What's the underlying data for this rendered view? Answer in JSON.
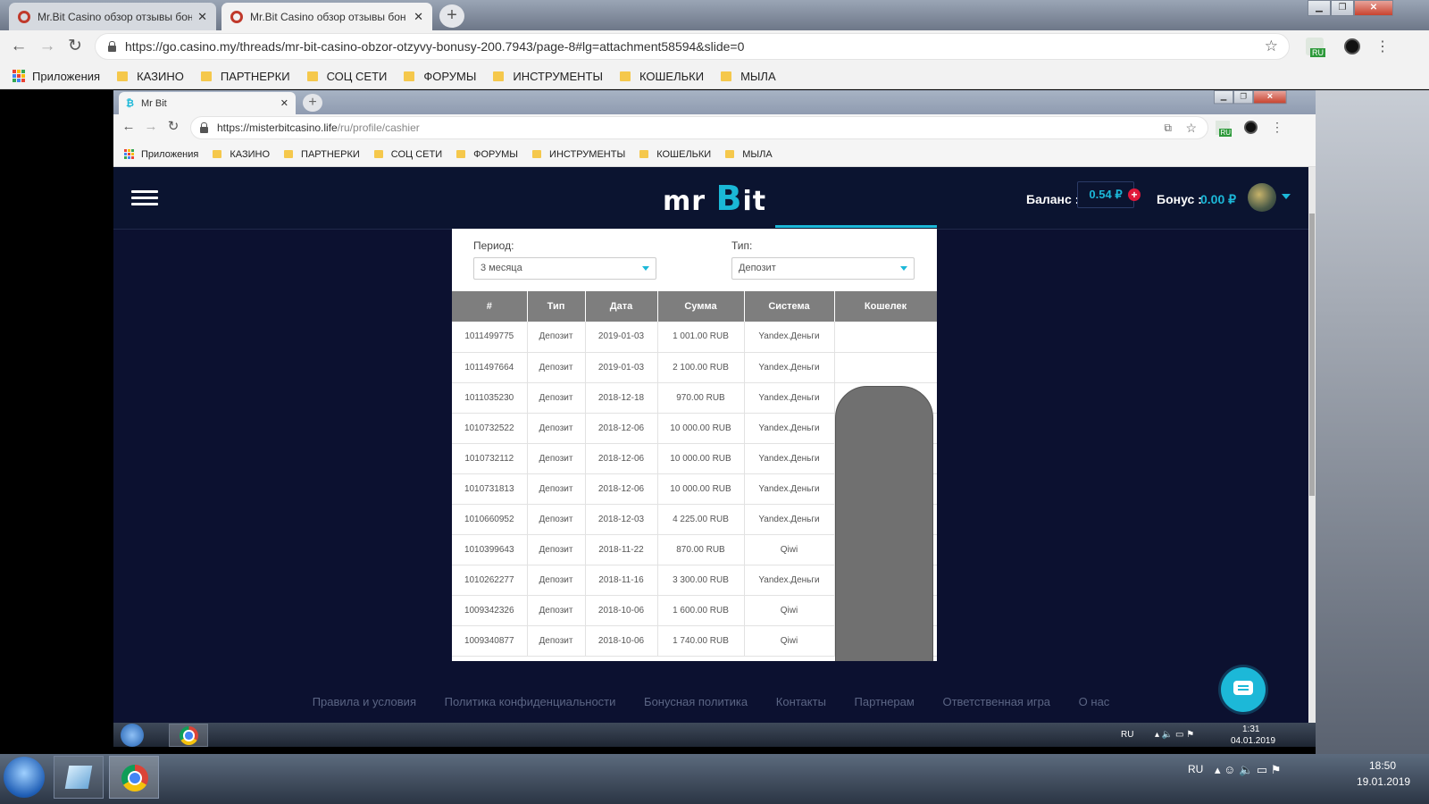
{
  "outer_browser": {
    "tabs": [
      {
        "title": "Mr.Bit Casino обзор отзывы бон",
        "active": false
      },
      {
        "title": "Mr.Bit Casino обзор отзывы бон",
        "active": true
      }
    ],
    "url": "https://go.casino.my/threads/mr-bit-casino-obzor-otzyvy-bonusy-200.7943/page-8#lg=attachment58594&slide=0",
    "ext_badge": "RU",
    "bookmarks": [
      "Приложения",
      "КАЗИНО",
      "ПАРТНЕРКИ",
      "СОЦ СЕТИ",
      "ФОРУМЫ",
      "ИНСТРУМЕНТЫ",
      "КОШЕЛЬКИ",
      "МЫЛА"
    ]
  },
  "inner_browser": {
    "tab_title": "Mr Bit",
    "url_host": "https://misterbitcasino.life",
    "url_path": "/ru/profile/cashier",
    "ext_badge": "RU",
    "bookmarks": [
      "Приложения",
      "КАЗИНО",
      "ПАРТНЕРКИ",
      "СОЦ СЕТИ",
      "ФОРУМЫ",
      "ИНСТРУМЕНТЫ",
      "КОШЕЛЬКИ",
      "МЫЛА"
    ]
  },
  "site": {
    "logo_left": "mr",
    "logo_b": "B",
    "logo_right": "it",
    "balance_label": "Баланс :",
    "balance_value": "0.54 ₽",
    "add_symbol": "+",
    "bonus_label": "Бонус :",
    "bonus_value": "0.00 ₽",
    "accent": "#1cb8d8",
    "bg": "#0c1130"
  },
  "filters": {
    "period_label": "Период:",
    "period_value": "3 месяца",
    "type_label": "Тип:",
    "type_value": "Депозит"
  },
  "table": {
    "headers": [
      "#",
      "Тип",
      "Дата",
      "Сумма",
      "Система",
      "Кошелек"
    ],
    "rows": [
      [
        "1011499775",
        "Депозит",
        "2019-01-03",
        "1 001.00 RUB",
        "Yandex.Деньги"
      ],
      [
        "1011497664",
        "Депозит",
        "2019-01-03",
        "2 100.00 RUB",
        "Yandex.Деньги"
      ],
      [
        "1011035230",
        "Депозит",
        "2018-12-18",
        "970.00 RUB",
        "Yandex.Деньги"
      ],
      [
        "1010732522",
        "Депозит",
        "2018-12-06",
        "10 000.00 RUB",
        "Yandex.Деньги"
      ],
      [
        "1010732112",
        "Депозит",
        "2018-12-06",
        "10 000.00 RUB",
        "Yandex.Деньги"
      ],
      [
        "1010731813",
        "Депозит",
        "2018-12-06",
        "10 000.00 RUB",
        "Yandex.Деньги"
      ],
      [
        "1010660952",
        "Депозит",
        "2018-12-03",
        "4 225.00 RUB",
        "Yandex.Деньги"
      ],
      [
        "1010399643",
        "Депозит",
        "2018-11-22",
        "870.00 RUB",
        "Qiwi"
      ],
      [
        "1010262277",
        "Депозит",
        "2018-11-16",
        "3 300.00 RUB",
        "Yandex.Деньги"
      ],
      [
        "1009342326",
        "Депозит",
        "2018-10-06",
        "1 600.00 RUB",
        "Qiwi"
      ],
      [
        "1009340877",
        "Депозит",
        "2018-10-06",
        "1 740.00 RUB",
        "Qiwi"
      ]
    ]
  },
  "footer_links": [
    "Правила и условия",
    "Политика конфиденциальности",
    "Бонусная политика",
    "Контакты",
    "Партнерам",
    "Ответственная игра",
    "О нас"
  ],
  "inner_taskbar": {
    "lang": "RU",
    "time": "1:31",
    "date": "04.01.2019"
  },
  "taskbar": {
    "lang": "RU",
    "time": "18:50",
    "date": "19.01.2019"
  }
}
